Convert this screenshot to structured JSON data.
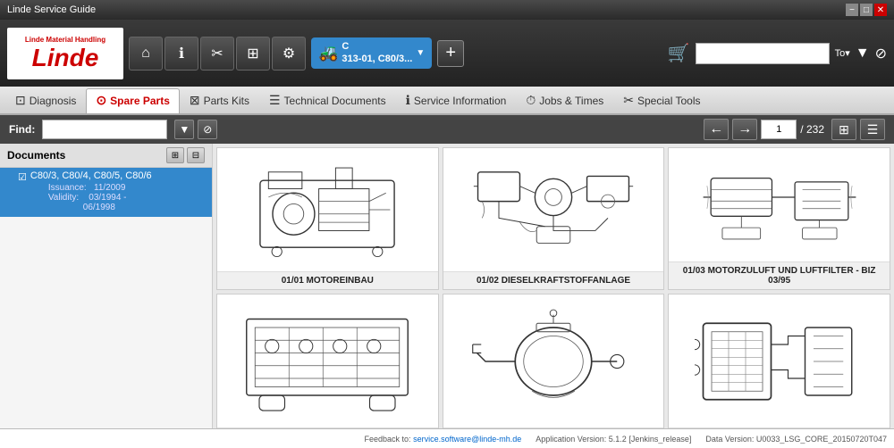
{
  "titlebar": {
    "text": "Linde Service Guide",
    "min": "−",
    "max": "□",
    "close": "✕"
  },
  "header": {
    "logo_top": "Linde Material Handling",
    "logo_text": "Linde",
    "toolbar_icons": [
      "⌂",
      "ℹ",
      "✕",
      "⊞",
      "⚙"
    ],
    "model": {
      "label": "C",
      "sublabel": "313-01, C80/3..."
    },
    "add_label": "+",
    "search_placeholder": "",
    "to_label": "To▾",
    "filter_icon": "▼",
    "filter2_icon": "⊘"
  },
  "nav": {
    "tabs": [
      {
        "label": "Diagnosis",
        "icon": "⊡",
        "active": false
      },
      {
        "label": "Spare Parts",
        "icon": "⊙",
        "active": true
      },
      {
        "label": "Parts Kits",
        "icon": "⊠",
        "active": false
      },
      {
        "label": "Technical Documents",
        "icon": "☰",
        "active": false
      },
      {
        "label": "Service Information",
        "icon": "ℹ",
        "active": false
      },
      {
        "label": "Jobs & Times",
        "icon": "⊘",
        "active": false
      },
      {
        "label": "Special Tools",
        "icon": "✕",
        "active": false
      }
    ]
  },
  "findbar": {
    "label": "Find:",
    "filter_icon": "▼",
    "clear_icon": "⊘",
    "prev_arrow": "←",
    "next_arrow": "→",
    "page_current": "1",
    "page_total": "/ 232",
    "view_grid": "⊞",
    "view_list": "☰"
  },
  "sidebar": {
    "title": "Documents",
    "icons": [
      "⊞",
      "⊟"
    ],
    "items": [
      {
        "name": "C80/3, C80/4, C80/5, C80/6",
        "issuance_label": "Issuance:",
        "issuance_value": "11/2009",
        "validity_label": "Validity:",
        "validity_value": "03/1994 -\n06/1998",
        "selected": true
      }
    ]
  },
  "grid": {
    "items": [
      {
        "id": "01/01",
        "label": "01/01 MOTOREINBAU"
      },
      {
        "id": "01/02",
        "label": "01/02 DIESELKRAFTSTOFFANLAGE"
      },
      {
        "id": "01/03",
        "label": "01/03 MOTORZULUFT UND LUFTFILTER - BIZ 03/95"
      },
      {
        "id": "01/04",
        "label": ""
      },
      {
        "id": "01/05",
        "label": ""
      },
      {
        "id": "01/06",
        "label": ""
      }
    ]
  },
  "statusbar": {
    "feedback_label": "Feedback to:",
    "feedback_email": "service.software@linde-mh.de",
    "app_version_label": "Application Version: 5.1.2 [Jenkins_release]",
    "data_version_label": "Data Version: U0033_LSG_CORE_20150720T047"
  }
}
